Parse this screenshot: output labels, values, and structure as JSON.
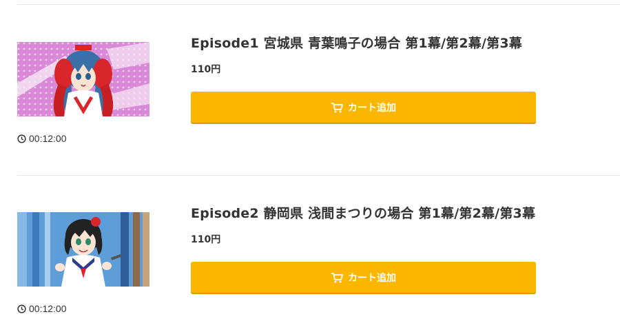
{
  "episodes": [
    {
      "title": "Episode1 宮城県 青葉鳴子の場合 第1幕/第2幕/第3幕",
      "price": "110円",
      "cart_label": "カート追加",
      "duration": "00:12:00"
    },
    {
      "title": "Episode2 静岡県 浅間まつりの場合 第1幕/第2幕/第3幕",
      "price": "110円",
      "cart_label": "カート追加",
      "duration": "00:12:00"
    }
  ],
  "colors": {
    "button": "#fbb700",
    "button_text": "#ffffff",
    "text": "#333333",
    "divider": "#e6e6e6"
  },
  "icons": {
    "cart": "cart-icon",
    "clock": "clock-icon"
  }
}
